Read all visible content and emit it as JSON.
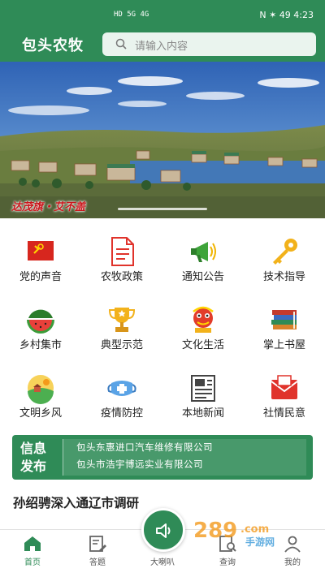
{
  "status": {
    "left": "HD 5G 4G",
    "right": "N ✶ 49 4:23"
  },
  "header": {
    "app_title": "包头农牧",
    "search_placeholder": "请输入内容"
  },
  "banner": {
    "caption": "达茂旗・艾不盖"
  },
  "grid": {
    "items": [
      {
        "label": "党的声音",
        "icon": "party-flag-icon"
      },
      {
        "label": "农牧政策",
        "icon": "policy-document-icon"
      },
      {
        "label": "通知公告",
        "icon": "megaphone-icon"
      },
      {
        "label": "技术指导",
        "icon": "key-icon"
      },
      {
        "label": "乡村集市",
        "icon": "watermelon-icon"
      },
      {
        "label": "典型示范",
        "icon": "trophy-icon"
      },
      {
        "label": "文化生活",
        "icon": "lion-dance-icon"
      },
      {
        "label": "掌上书屋",
        "icon": "books-icon"
      },
      {
        "label": "文明乡风",
        "icon": "countryside-icon"
      },
      {
        "label": "疫情防控",
        "icon": "mask-icon"
      },
      {
        "label": "本地新闻",
        "icon": "newspaper-icon"
      },
      {
        "label": "社情民意",
        "icon": "envelope-icon"
      }
    ]
  },
  "info": {
    "badge_line1": "信息",
    "badge_line2": "发布",
    "items": [
      "包头东惠进口汽车维修有限公司",
      "包头市浩宇博远实业有限公司"
    ]
  },
  "headline": "孙绍骋深入通辽市调研",
  "tabbar": {
    "tabs": [
      {
        "label": "首页",
        "icon": "home-icon",
        "active": true
      },
      {
        "label": "答题",
        "icon": "quiz-icon",
        "active": false
      },
      {
        "label": "大喇叭",
        "icon": "speaker-icon",
        "active": false
      },
      {
        "label": "查询",
        "icon": "query-icon",
        "active": false
      },
      {
        "label": "我的",
        "icon": "profile-icon",
        "active": false
      }
    ]
  },
  "watermark": "289.com 手游网",
  "colors": {
    "brand_green": "#2f8b57",
    "party_red": "#d7261e"
  }
}
